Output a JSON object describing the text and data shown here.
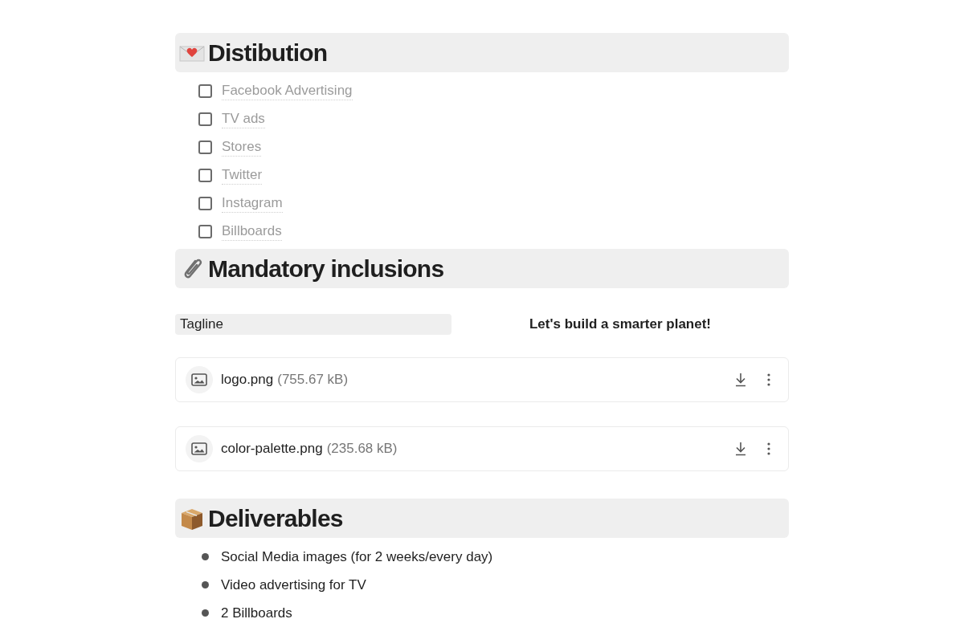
{
  "blocks": [
    {
      "kind": "heading",
      "text": "Distibution"
    },
    {
      "kind": "checklist",
      "items": [
        {
          "label": "Facebook Advertising",
          "checked": false
        },
        {
          "label": "TV ads",
          "checked": false
        },
        {
          "label": "Stores",
          "checked": false
        },
        {
          "label": "Twitter",
          "checked": false
        },
        {
          "label": "Instagram",
          "checked": false
        },
        {
          "label": "Billboards",
          "checked": false
        }
      ]
    },
    {
      "kind": "heading",
      "text": "Mandatory inclusions"
    },
    {
      "kind": "property",
      "label": "Tagline",
      "value": "Let's build a smarter planet!"
    },
    {
      "kind": "file",
      "name": "logo.png",
      "size": "(755.67 kB)"
    },
    {
      "kind": "file",
      "name": "color-palette.png",
      "size": "(235.68 kB)"
    },
    {
      "kind": "heading",
      "text": "Deliverables"
    },
    {
      "kind": "bullets",
      "items": [
        "Social Media images (for 2 weeks/every day)",
        "Video advertising for TV",
        "2 Billboards"
      ]
    }
  ]
}
